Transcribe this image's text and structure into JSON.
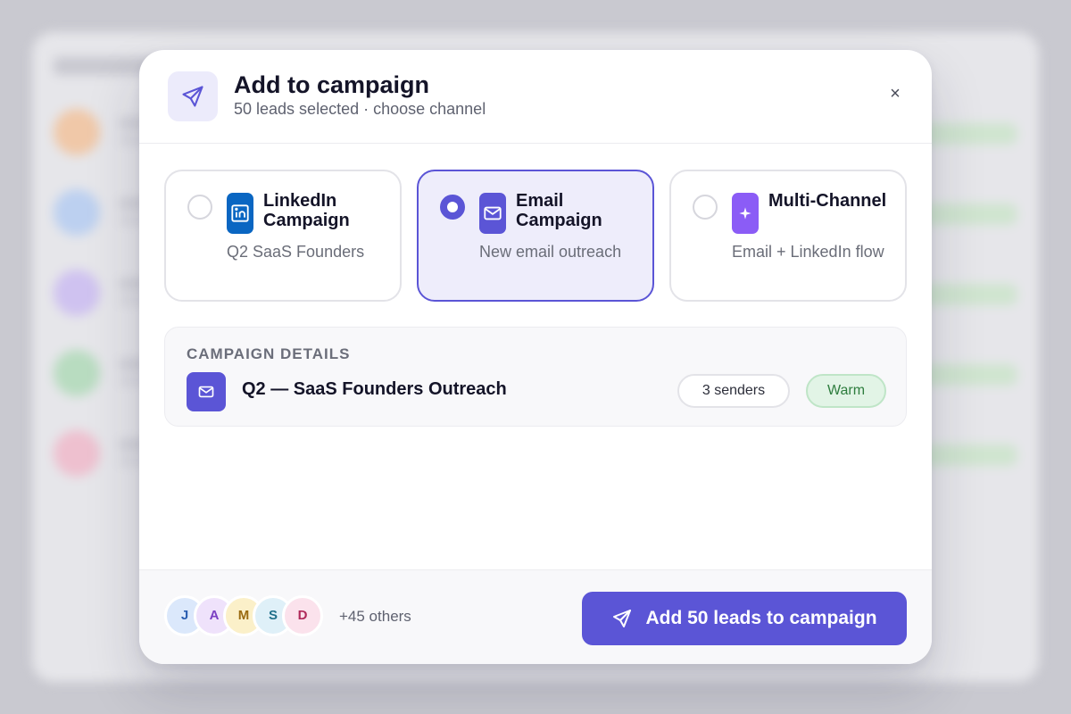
{
  "modal": {
    "title": "Add to campaign",
    "subtitle": "50 leads selected · choose channel",
    "close_label": "×"
  },
  "channels": [
    {
      "title": "LinkedIn Campaign",
      "description": "Q2 SaaS Founders",
      "selected": false,
      "icon": "linkedin-icon",
      "color": "#0a66c2"
    },
    {
      "title": "Email Campaign",
      "description": "New email outreach",
      "selected": true,
      "icon": "mail-icon",
      "color": "#5b55d6"
    },
    {
      "title": "Multi-Channel",
      "description": "Email + LinkedIn flow",
      "selected": false,
      "icon": "sparkle-icon",
      "color": "#8b5cf6"
    }
  ],
  "details": {
    "label": "CAMPAIGN DETAILS",
    "name": "Q2 — SaaS Founders Outreach",
    "senders": "3 senders",
    "temperature": "Warm"
  },
  "footer": {
    "avatars": [
      {
        "initial": "J",
        "bg": "#dbe8fb",
        "fg": "#2a5db0"
      },
      {
        "initial": "A",
        "bg": "#efe2fb",
        "fg": "#7a3fc2"
      },
      {
        "initial": "M",
        "bg": "#fbf0c9",
        "fg": "#9a6a10"
      },
      {
        "initial": "S",
        "bg": "#dff0f8",
        "fg": "#1f6f8a"
      },
      {
        "initial": "D",
        "bg": "#fbe2ec",
        "fg": "#b02a5a"
      }
    ],
    "others": "+45 others",
    "primary_label": "Add 50 leads to campaign"
  },
  "colors": {
    "accent": "#5b55d6",
    "success": "#2e7d3e"
  }
}
